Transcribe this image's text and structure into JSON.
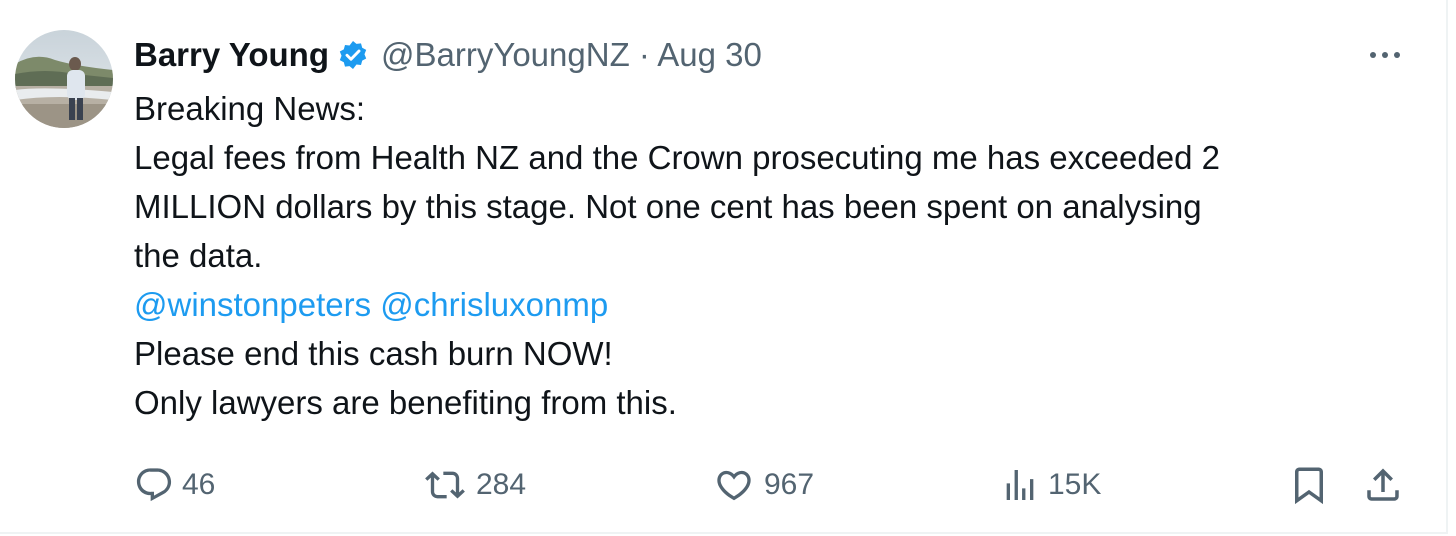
{
  "tweet": {
    "author": {
      "display_name": "Barry Young",
      "verified": true,
      "handle": "@BarryYoungNZ",
      "separator": "·",
      "date": "Aug 30"
    },
    "body": {
      "line1": "Breaking News:",
      "line2": "Legal fees from Health NZ and the Crown prosecuting me has exceeded 2",
      "line3": "MILLION dollars by this stage.  Not one cent has been spent on analysing",
      "line4": "the data.",
      "mention1": "@winstonpeters",
      "mention2": "@chrisluxonmp",
      "line6": "Please end this cash burn NOW!",
      "line7": "Only lawyers are benefiting from this."
    },
    "stats": {
      "replies": "46",
      "retweets": "284",
      "likes": "967",
      "views": "15K"
    }
  },
  "colors": {
    "text": "#0f1419",
    "muted": "#536471",
    "accent": "#1d9bf0"
  },
  "icons": {
    "reply": "reply-icon",
    "retweet": "retweet-icon",
    "like": "heart-icon",
    "views": "views-icon",
    "bookmark": "bookmark-icon",
    "share": "share-icon",
    "more": "more-icon",
    "verified": "verified-badge-icon"
  }
}
